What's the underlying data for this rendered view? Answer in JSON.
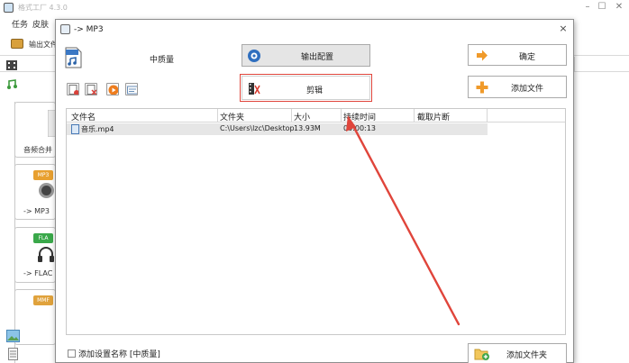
{
  "app": {
    "title": "格式工厂 4.3.0",
    "menu": [
      "任务",
      "皮肤"
    ],
    "toolbar_output_label": "输出文件"
  },
  "sidebar": {
    "cards": [
      {
        "label": "音频合并"
      },
      {
        "label": "-> MP3",
        "badge": "MP3",
        "badge_color": "#e8a030"
      },
      {
        "label": "-> FLAC",
        "badge": "FLA",
        "badge_color": "#3aa84a"
      },
      {
        "label": "",
        "badge": "MMF",
        "badge_color": "#e0a23c"
      }
    ]
  },
  "dialog": {
    "title": "-> MP3",
    "close_glyph": "×",
    "quality": "中质量",
    "output_settings_label": "输出配置",
    "cut_label": "剪辑",
    "ok_label": "确定",
    "add_file_label": "添加文件",
    "add_folder_label": "添加文件夹",
    "checkbox_label": "添加设置名称 [中质量]",
    "table": {
      "headers": [
        "文件名",
        "文件夹",
        "大小",
        "持续时间",
        "截取片断"
      ],
      "rows": [
        {
          "name": "音乐.mp4",
          "folder": "C:\\Users\\lzc\\Desktop",
          "size": "13.93M",
          "duration": "00:00:13",
          "clip": ""
        }
      ]
    }
  },
  "colors": {
    "highlight": "#e0453b",
    "arrow": "#e0453b"
  }
}
